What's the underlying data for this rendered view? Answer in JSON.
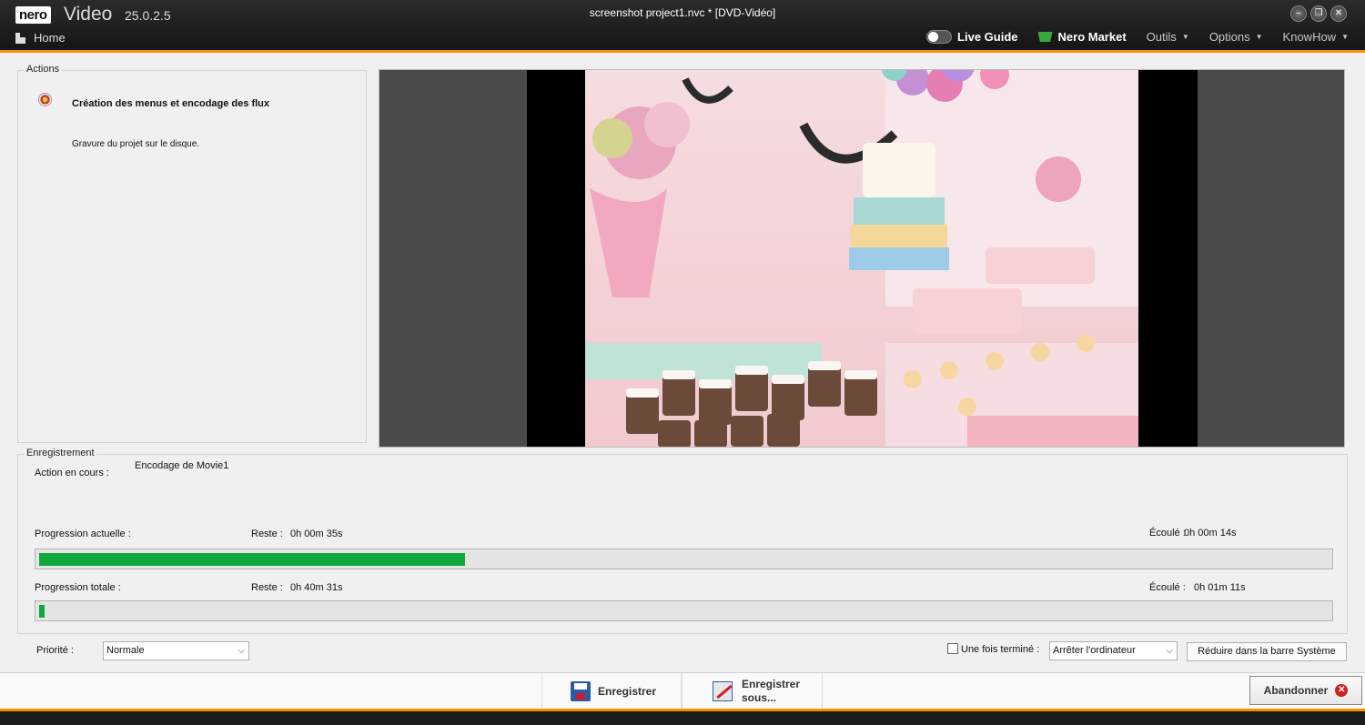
{
  "titlebar": {
    "logo": "nero",
    "app_name": "Video",
    "version": "25.0.2.5",
    "document_title": "screenshot project1.nvc * [DVD-Vidéo]",
    "home_label": "Home",
    "window_controls": [
      "minimize-icon",
      "restore-icon",
      "close-icon"
    ]
  },
  "nav": {
    "live_guide": "Live Guide",
    "nero_market": "Nero Market",
    "outils": "Outils",
    "options": "Options",
    "knowhow": "KnowHow"
  },
  "actions": {
    "legend": "Actions",
    "title": "Création des menus et encodage des flux",
    "subtitle": "Gravure du projet sur le disque."
  },
  "recording": {
    "legend": "Enregistrement",
    "action_label": "Action en cours :",
    "action_value": "Encodage de Movie1",
    "current": {
      "label": "Progression actuelle :",
      "remaining_label": "Reste :",
      "remaining_value": "0h 00m 35s",
      "elapsed_label": "Écoulé :",
      "elapsed_value": "0h 00m 14s",
      "progress": 0.33
    },
    "total": {
      "label": "Progression totale :",
      "remaining_label": "Reste :",
      "remaining_value": "0h 40m 31s",
      "elapsed_label": "Écoulé :",
      "elapsed_value": "0h 01m 11s",
      "progress": 0.004
    }
  },
  "options_row": {
    "priority_label": "Priorité :",
    "priority_value": "Normale",
    "when_done_label": "Une fois terminé :",
    "when_done_checked": false,
    "when_done_value": "Arrêter l'ordinateur",
    "minimize_button": "Réduire dans la barre Système"
  },
  "toolbar": {
    "save_label": "Enregistrer",
    "save_as_line1": "Enregistrer",
    "save_as_line2": "sous...",
    "abandon_label": "Abandonner"
  },
  "colors": {
    "accent": "#f39200",
    "progress_fill": "#0fa83a"
  }
}
